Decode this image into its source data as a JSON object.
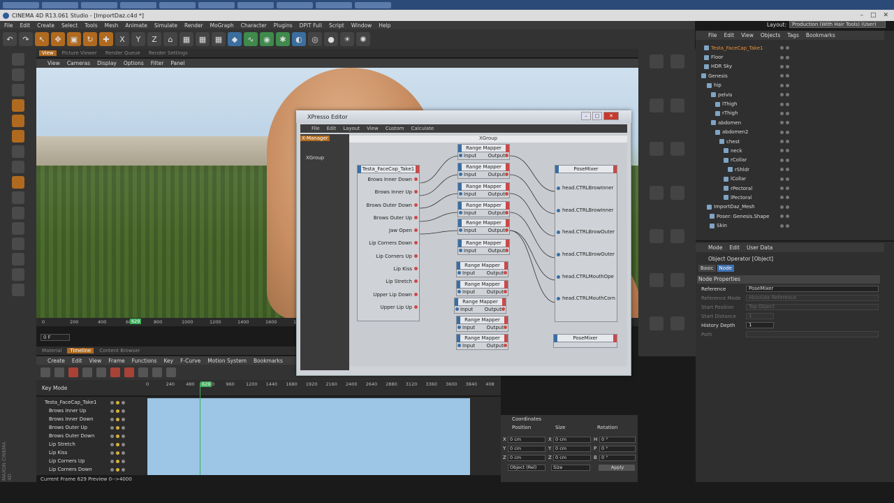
{
  "window_title": "CINEMA 4D R13.061 Studio - [ImportDaz.c4d *]",
  "menubar": [
    "File",
    "Edit",
    "Create",
    "Select",
    "Tools",
    "Mesh",
    "Animate",
    "Simulate",
    "Render",
    "MoGraph",
    "Character",
    "Plugins",
    "DPIT Full",
    "Script",
    "Window",
    "Help"
  ],
  "layout": {
    "label": "Layout:",
    "value": "Production (With Hair Tools) (User)"
  },
  "viewport": {
    "tabs": [
      "View",
      "Picture Viewer",
      "Render Queue",
      "Render Settings"
    ],
    "menu": [
      "View",
      "Cameras",
      "Display",
      "Options",
      "Filter",
      "Panel"
    ],
    "ruler": [
      "0",
      "200",
      "400",
      "600",
      "800",
      "1000",
      "1200",
      "1400",
      "1600",
      "18"
    ],
    "current_frame": "629",
    "frame_field": "0 F"
  },
  "timeline": {
    "tabs": [
      "Material",
      "Timeline",
      "Content Browser"
    ],
    "menu": [
      "Create",
      "Edit",
      "View",
      "Frame",
      "Functions",
      "Key",
      "F-Curve",
      "Motion System",
      "Bookmarks"
    ],
    "key_mode": "Key Mode",
    "ruler": [
      "0",
      "240",
      "480",
      "720",
      "960",
      "1200",
      "1440",
      "1680",
      "1920",
      "2160",
      "2400",
      "2640",
      "2880",
      "3120",
      "3360",
      "3600",
      "3840",
      "408"
    ],
    "playhead": "629",
    "tracks": [
      "Testa_FaceCap_Take1",
      "Brows Inner Up",
      "Brows Inner Down",
      "Brows Outer Up",
      "Brows Outer Down",
      "Lip Stretch",
      "Lip Kiss",
      "Lip Corners Up",
      "Lip Corners Down"
    ],
    "status": "Current Frame  629  Preview  0-->4000"
  },
  "coordinates": {
    "title": "Coordinates",
    "headers": [
      "Position",
      "Size",
      "Rotation"
    ],
    "rows": [
      {
        "axis": "X",
        "pos": "0 cm",
        "sizeaxis": "X",
        "size": "0 cm",
        "rotaxis": "H",
        "rot": "0 °"
      },
      {
        "axis": "Y",
        "pos": "0 cm",
        "sizeaxis": "Y",
        "size": "0 cm",
        "rotaxis": "P",
        "rot": "0 °"
      },
      {
        "axis": "Z",
        "pos": "0 cm",
        "sizeaxis": "Z",
        "size": "0 cm",
        "rotaxis": "B",
        "rot": "0 °"
      }
    ],
    "mode": "Object (Rel)",
    "size_mode": "Size",
    "apply": "Apply"
  },
  "object_manager": {
    "menu": [
      "File",
      "Edit",
      "View",
      "Objects",
      "Tags",
      "Bookmarks"
    ],
    "items": [
      {
        "label": "Testa_FaceCap_Take1",
        "sel": true
      },
      {
        "label": "Floor"
      },
      {
        "label": "HDR Sky"
      },
      {
        "label": "Genesis"
      },
      {
        "label": "hip"
      },
      {
        "label": "pelvis"
      },
      {
        "label": "lThigh"
      },
      {
        "label": "rThigh"
      },
      {
        "label": "abdomen"
      },
      {
        "label": "abdomen2"
      },
      {
        "label": "chest"
      },
      {
        "label": "neck"
      },
      {
        "label": "rCollar"
      },
      {
        "label": "rShldr"
      },
      {
        "label": "lCollar"
      },
      {
        "label": "rPectoral"
      },
      {
        "label": "lPectoral"
      },
      {
        "label": "ImportDaz_Mesh"
      },
      {
        "label": "Poser: Genesis.Shape"
      },
      {
        "label": "Skin"
      }
    ]
  },
  "attributes": {
    "menu": [
      "Mode",
      "Edit",
      "User Data"
    ],
    "title": "Object Operator [Object]",
    "tabs": [
      "Basic",
      "Node"
    ],
    "section": "Node Properties",
    "rows": [
      {
        "label": "Reference",
        "value": "PoseMixer",
        "dim": false
      },
      {
        "label": "Reference Mode",
        "value": "Absolute Reference",
        "dim": true
      },
      {
        "label": "Start Position",
        "value": "Top Object",
        "dim": true
      },
      {
        "label": "Start Distance",
        "value": "1",
        "dim": true
      },
      {
        "label": "History Depth",
        "value": "1",
        "dim": false
      },
      {
        "label": "Path",
        "value": "",
        "dim": true
      }
    ]
  },
  "xpresso": {
    "title": "XPresso Editor",
    "menu": [
      "File",
      "Edit",
      "Layout",
      "View",
      "Custom",
      "Calculate"
    ],
    "left_tabs": [
      "X-Manager"
    ],
    "xgroup_label": "XGroup",
    "canvas_title": "XGroup",
    "source_node": {
      "title": "Testa_FaceCap_Take1",
      "ports": [
        "Brows Inner Down",
        "Brows Inner Up",
        "Brows Outer Down",
        "Brows Outer Up",
        "Jaw Open",
        "Lip Corners Down",
        "Lip Corners Up",
        "Lip Kiss",
        "Lip Stretch",
        "Upper Lip Down",
        "Upper Lip Up"
      ]
    },
    "mapper": {
      "title": "Range Mapper",
      "input": "Input",
      "output": "Output",
      "count": 11
    },
    "posemixer": {
      "title": "PoseMixer",
      "ports": [
        "head.CTRLBrowInner",
        "head.CTRLBrowInner",
        "head.CTRLBrowOuter",
        "head.CTRLBrowOuter",
        "head.CTRLMouthOpe",
        "head.CTRLMouthCorn"
      ]
    },
    "posemixer2": {
      "title": "PoseMixer"
    }
  }
}
